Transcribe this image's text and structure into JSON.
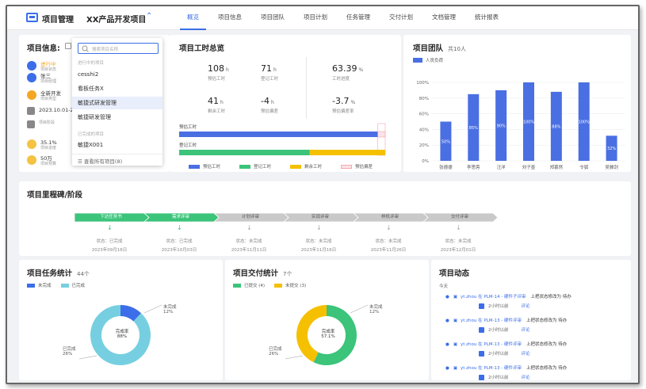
{
  "header": {
    "brand": "项目管理",
    "project": "XX产品开发项目",
    "tabs": [
      "概览",
      "项目信息",
      "项目团队",
      "项目计划",
      "任务管理",
      "交付计划",
      "文档管理",
      "统计报表"
    ]
  },
  "info": {
    "title": "项目信息:",
    "items": [
      {
        "value": "进行中",
        "label": "项目状态",
        "color": "#3b6ee8",
        "vcolor": "#f5a623"
      },
      {
        "value": "张三",
        "label": "项目经理",
        "color": "#3b6ee8",
        "vcolor": "#333"
      },
      {
        "value": "全新开发",
        "label": "项目类型",
        "color": "#f5a623",
        "vcolor": "#333"
      },
      {
        "value": "2023.10.01-2",
        "label": "",
        "color": "#888",
        "vcolor": "#333"
      },
      {
        "value": "",
        "label": "项目阶段",
        "color": "#888",
        "vcolor": "#333"
      },
      {
        "value": "35.1%",
        "label": "项目进度",
        "color": "#f5c242",
        "vcolor": "#333"
      },
      {
        "value": "50万",
        "label": "项目预算",
        "color": "#f5c242",
        "vcolor": "#333"
      }
    ]
  },
  "dropdown": {
    "placeholder": "搜索项目名称",
    "group1": "进行中的项目",
    "items1": [
      "cesshi2",
      "看板任务X",
      "敏捷式研发管理",
      "敏捷研发管理"
    ],
    "group2": "已完成的项目",
    "items2": [
      "敏捷X001"
    ],
    "footer": "查看所有项目(8)"
  },
  "hours": {
    "title": "项目工时总览",
    "stats": [
      {
        "num": "108",
        "unit": "h",
        "label": "预估工时"
      },
      {
        "num": "71",
        "unit": "h",
        "label": "登记工时"
      },
      {
        "num": "63.39",
        "unit": "%",
        "label": "工时进度"
      },
      {
        "num": "41",
        "unit": "h",
        "label": "剩余工时"
      },
      {
        "num": "-4",
        "unit": "h",
        "label": "预估偏差"
      },
      {
        "num": "-3.7",
        "unit": "%",
        "label": "预估偏差率"
      }
    ],
    "bar1": "预估工时",
    "bar2": "登记工时",
    "legend": [
      "预估工时",
      "登记工时",
      "剩余工时",
      "预估偏差"
    ]
  },
  "team": {
    "title": "项目团队",
    "count": "共10人",
    "legend": "人员负荷",
    "yticks": [
      "100%",
      "80%",
      "60%",
      "40%",
      "20%",
      "0%"
    ]
  },
  "milestones": {
    "title": "项目里程碑/阶段",
    "stages": [
      {
        "name": "下达任务书",
        "status": "状态：已完成",
        "date": "2023年09月16日",
        "done": true
      },
      {
        "name": "需求评审",
        "status": "状态：已完成",
        "date": "2023年10月03日",
        "done": true
      },
      {
        "name": "计划评审",
        "status": "状态：未完成",
        "date": "2023年11月11日",
        "done": false
      },
      {
        "name": "实现评审",
        "status": "状态：未完成",
        "date": "2023年11月16日",
        "done": false
      },
      {
        "name": "样机评审",
        "status": "状态：未完成",
        "date": "2023年11月26日",
        "done": false
      },
      {
        "name": "交付评审",
        "status": "状态：未完成",
        "date": "2023年12月01日",
        "done": false
      }
    ]
  },
  "tasks": {
    "title": "项目任务统计",
    "count": "44个",
    "legend": [
      "未完成",
      "已完成"
    ],
    "center1": "完成率",
    "center2": "88%",
    "lab1": "未完成",
    "lab1v": "12%",
    "lab2": "已完成",
    "lab2v": "26%"
  },
  "deliver": {
    "title": "项目交付统计",
    "count": "7个",
    "legend": [
      "已提交 (4)",
      "未提交 (3)"
    ],
    "center1": "完成率",
    "center2": "57.1%",
    "lab1": "未完成",
    "lab1v": "12%",
    "lab2": "已完成",
    "lab2v": "26%"
  },
  "activity": {
    "title": "项目动态",
    "today": "今天",
    "items": [
      {
        "line1": "yt.zhou 在 PLM-14 - 硬件子评审",
        "tail": "上把状态修改为 待办",
        "time": "2小时以前",
        "comment": "评论"
      },
      {
        "line1": "yt.zhou 在 PLM-13 - 硬件评审",
        "tail": "上把状态修改为 待办",
        "time": "2小时以前",
        "comment": "评论"
      },
      {
        "line1": "yt.zhou 在 PLM-13 - 硬件评审",
        "tail": "上把状态修改为 待办",
        "time": "2小时以前",
        "comment": "评论"
      },
      {
        "line1": "yt.zhou 在 PLM-13 - 硬件评审",
        "tail": "上把状态修改为 待办",
        "time": "2小时以前",
        "comment": "评论"
      }
    ]
  },
  "chart_data": [
    {
      "type": "bar",
      "title": "项目团队",
      "categories": [
        "张德德",
        "李思旁",
        "汪洋",
        "刘子墨",
        "郑慕然",
        "令狐",
        "吴雅剑"
      ],
      "series": [
        {
          "name": "人员负荷",
          "values": [
            50,
            85,
            90,
            100,
            88,
            100,
            32
          ]
        }
      ],
      "value_labels": [
        "50%",
        "85%",
        "90%",
        "100%",
        "88%",
        "100%",
        "32%"
      ],
      "ylim": [
        0,
        100
      ],
      "grid": true,
      "legend": "top-left"
    },
    {
      "type": "bar",
      "title": "项目工时总览",
      "orientation": "horizontal",
      "categories": [
        "预估工时",
        "登记工时"
      ],
      "series": [
        {
          "name": "预估工时",
          "values": [
            108,
            0
          ]
        },
        {
          "name": "登记工时",
          "values": [
            0,
            71
          ]
        },
        {
          "name": "剩余工时",
          "values": [
            0,
            41
          ]
        },
        {
          "name": "预估偏差",
          "values": [
            4,
            0
          ]
        }
      ]
    },
    {
      "type": "pie",
      "title": "项目任务统计",
      "labels": [
        "未完成",
        "已完成"
      ],
      "values": [
        12,
        88
      ],
      "colors": [
        "#3b6ee8",
        "#76cfe0"
      ]
    },
    {
      "type": "pie",
      "title": "项目交付统计",
      "labels": [
        "已提交",
        "未提交"
      ],
      "values": [
        57.1,
        42.9
      ],
      "colors": [
        "#3bc47a",
        "#f5c000"
      ]
    }
  ]
}
